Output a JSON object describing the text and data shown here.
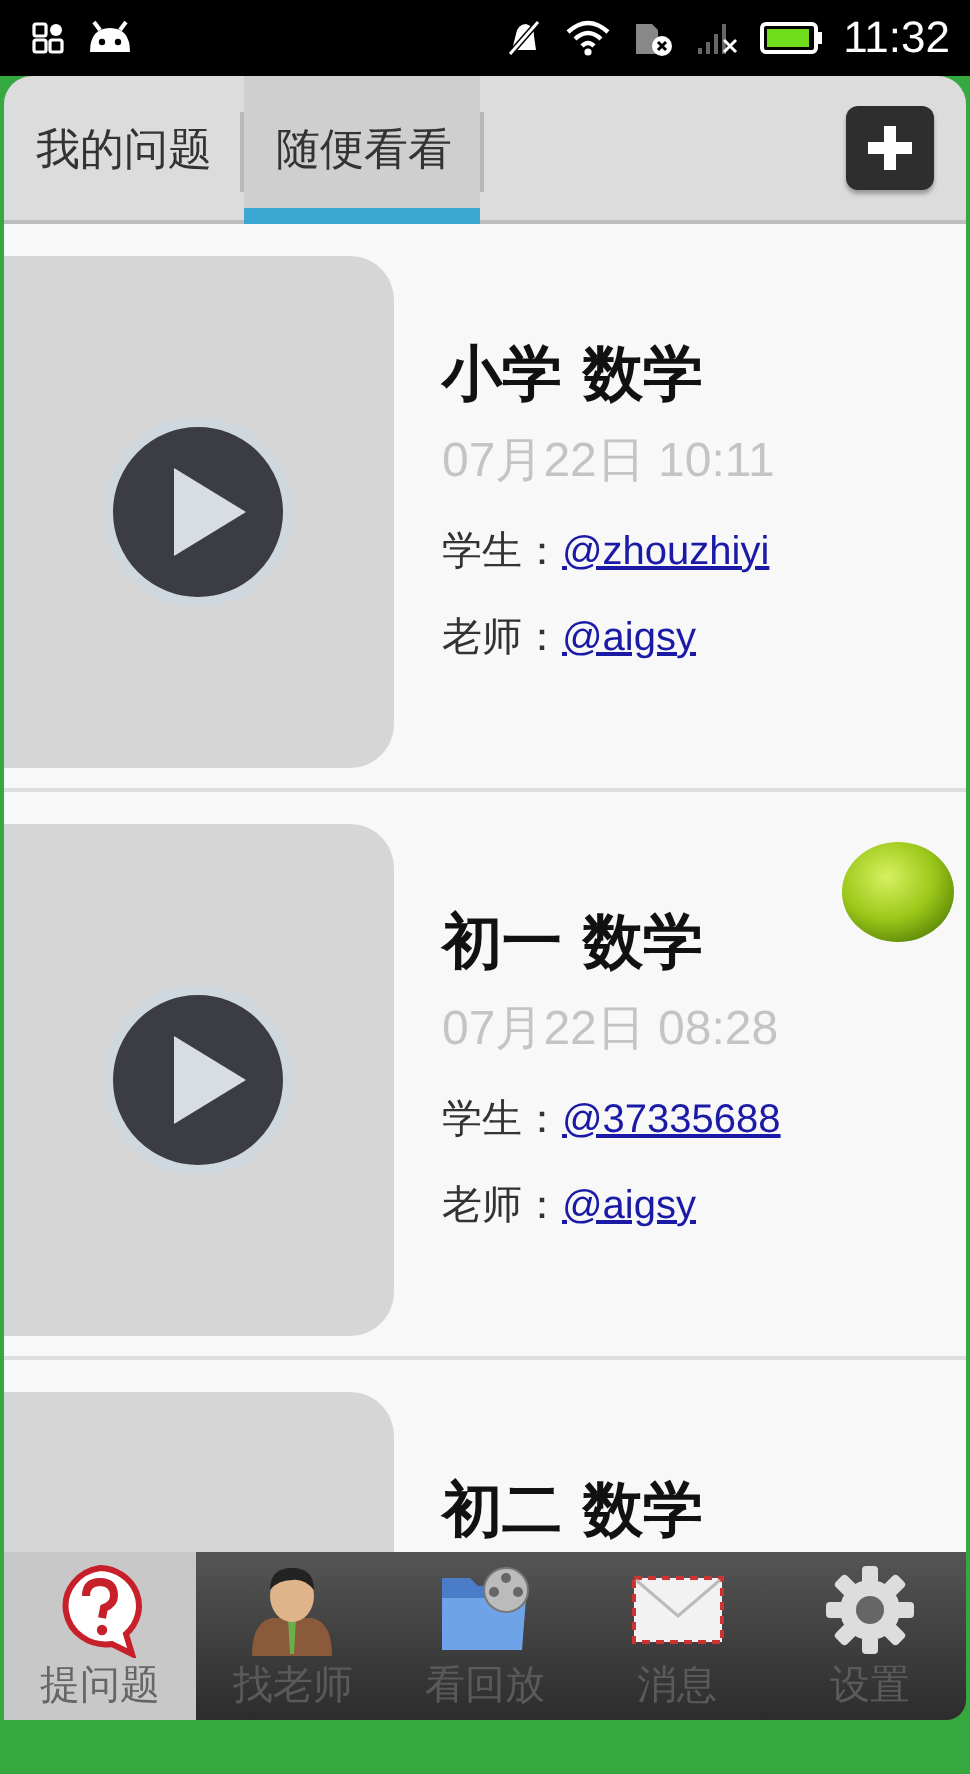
{
  "status_bar": {
    "time": "11:32"
  },
  "tabs": [
    {
      "label": "我的问题",
      "selected": false
    },
    {
      "label": "随便看看",
      "selected": true
    }
  ],
  "posts": [
    {
      "title": "小学 数学",
      "date": "07月22日 10:11",
      "student_label": "学生：",
      "student": "@zhouzhiyi",
      "teacher_label": "老师：",
      "teacher": "@aigsy"
    },
    {
      "title": "初一 数学",
      "date": "07月22日 08:28",
      "student_label": "学生：",
      "student": "@37335688",
      "teacher_label": "老师：",
      "teacher": "@aigsy"
    },
    {
      "title": "初二 数学"
    }
  ],
  "nav": [
    {
      "label": "提问题",
      "selected": true,
      "kind": "question"
    },
    {
      "label": "找老师",
      "selected": false,
      "kind": "teacher"
    },
    {
      "label": "看回放",
      "selected": false,
      "kind": "replay"
    },
    {
      "label": "消息",
      "selected": false,
      "kind": "message"
    },
    {
      "label": "设置",
      "selected": false,
      "kind": "settings"
    }
  ]
}
